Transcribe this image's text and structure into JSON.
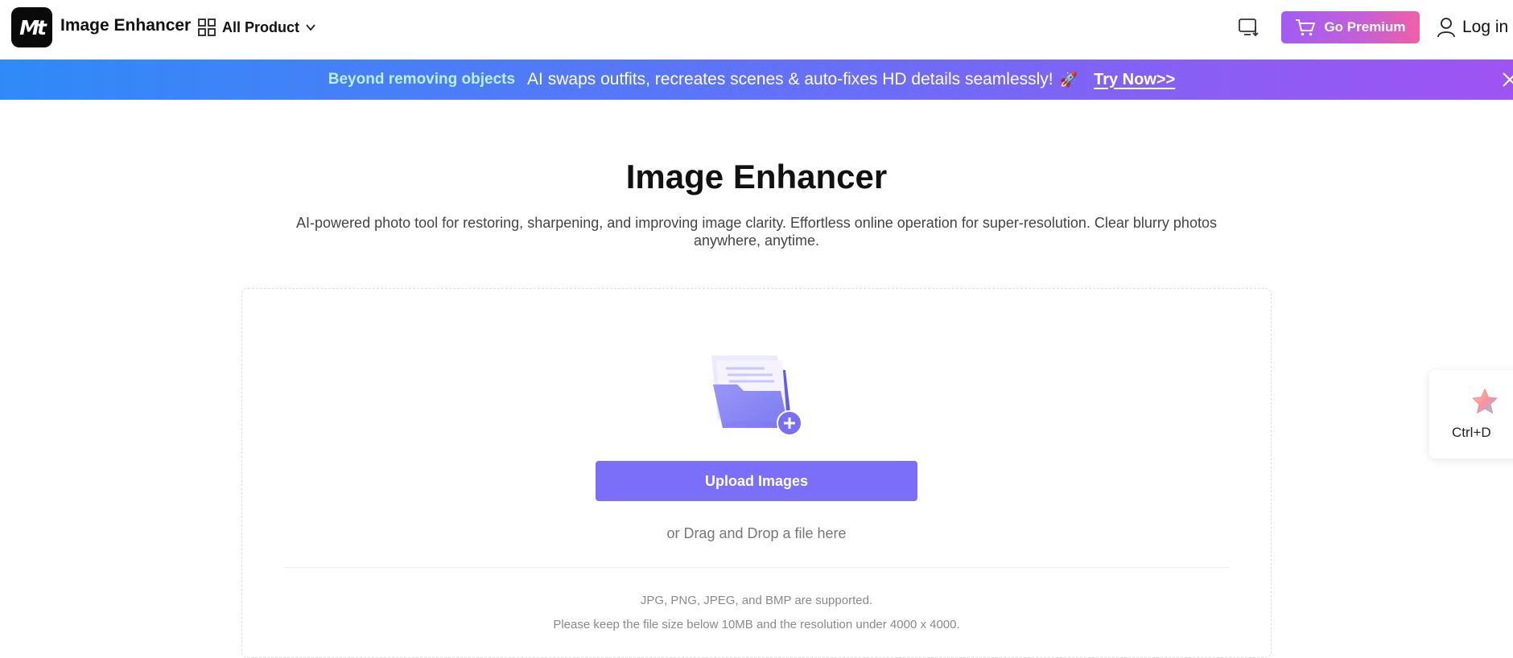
{
  "header": {
    "logo_text": "Mt",
    "app_title": "Image Enhancer",
    "all_product_label": "All Product",
    "premium_label": "Go Premium",
    "login_label": "Log in"
  },
  "banner": {
    "highlight": "Beyond removing objects",
    "text": "AI swaps outfits, recreates scenes & auto-fixes HD details seamlessly!",
    "emoji": "🚀",
    "cta": "Try Now>>"
  },
  "main": {
    "title": "Image Enhancer",
    "subtitle": "AI-powered photo tool for restoring, sharpening, and improving image clarity. Effortless online operation for super-resolution. Clear blurry photos anywhere, anytime.",
    "upload_button": "Upload Images",
    "drag_text": "or Drag and Drop a file here",
    "supported_formats": "JPG, PNG, JPEG, and BMP are supported.",
    "size_limit": "Please keep the file size below 10MB and the resolution under 4000 x 4000."
  },
  "bookmark": {
    "label": "Ctrl+D"
  },
  "icons": {
    "grid": "grid-icon",
    "chevron": "chevron-down-icon",
    "install": "monitor-download-icon",
    "cart": "cart-icon",
    "user": "user-icon",
    "close": "close-icon",
    "folder": "folder-upload-icon",
    "star": "star-icon"
  },
  "colors": {
    "primary": "#7b6ffa",
    "premium_gradient_start": "#a15cf5",
    "premium_gradient_end": "#ef5fa7",
    "banner_gradient_start": "#2f8af8",
    "banner_gradient_end": "#9f53f3",
    "banner_highlight": "#b8f0ff"
  }
}
